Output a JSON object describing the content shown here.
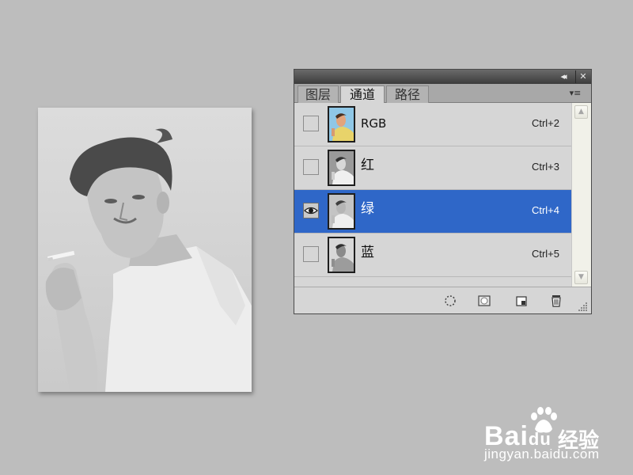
{
  "panel": {
    "collapse_glyph": "◂◂",
    "close_glyph": "✕",
    "menu_glyph": "▾≡",
    "tabs": [
      {
        "label": "图层",
        "active": false
      },
      {
        "label": "通道",
        "active": true
      },
      {
        "label": "路径",
        "active": false
      }
    ],
    "channels": [
      {
        "name": "RGB",
        "shortcut": "Ctrl+2",
        "visible": false,
        "selected": false
      },
      {
        "name": "红",
        "shortcut": "Ctrl+3",
        "visible": false,
        "selected": false
      },
      {
        "name": "绿",
        "shortcut": "Ctrl+4",
        "visible": true,
        "selected": true
      },
      {
        "name": "蓝",
        "shortcut": "Ctrl+5",
        "visible": false,
        "selected": false
      }
    ],
    "scroll_up_glyph": "▲",
    "scroll_down_glyph": "▼",
    "footer_icons": [
      "load-selection-icon",
      "save-selection-icon",
      "new-channel-icon",
      "trash-icon"
    ]
  },
  "colors": {
    "selected_row": "#2f67c8",
    "background": "#bdbdbd"
  },
  "watermark": {
    "brand_latin": "Bai",
    "brand_paw": "du",
    "brand_cn": "经验",
    "url": "jingyan.baidu.com"
  }
}
